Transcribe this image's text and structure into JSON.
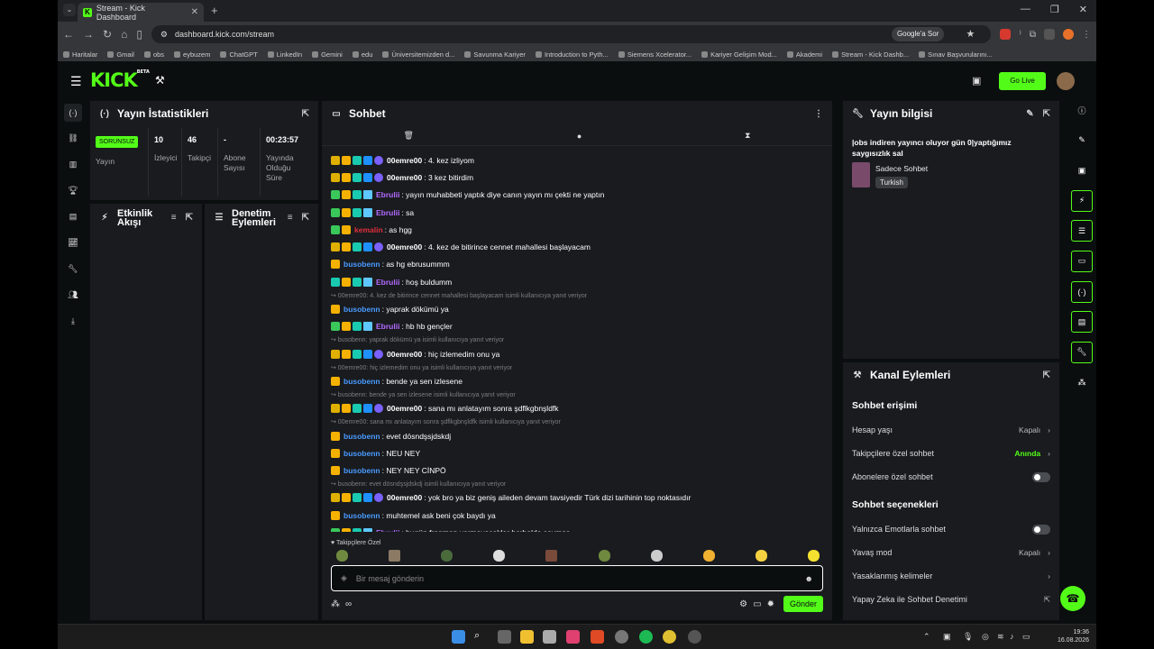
{
  "browser": {
    "tab_title": "Stream - Kick Dashboard",
    "url": "dashboard.kick.com/stream",
    "google_button": "Google'a Sor",
    "bookmarks": [
      "Haritalar",
      "Gmail",
      "obs",
      "eybuzem",
      "ChatGPT",
      "LinkedIn",
      "Gemini",
      "edu",
      "Üniversitemizden d...",
      "Savunma Kariyer",
      "Introduction to Pyth...",
      "Siemens Xcelerator...",
      "Kariyer Gelişim Mod...",
      "Akademi",
      "Stream - Kick Dashb...",
      "Sınav Başvurularını..."
    ]
  },
  "header": {
    "logo": "KICK",
    "logo_sup": "BETA",
    "go_live": "Go Live"
  },
  "stats": {
    "title": "Yayın İstatistikleri",
    "badge": "SORUNSUZ",
    "badge_label": "Yayın",
    "viewers": "10",
    "viewers_label": "İzleyici",
    "followers": "46",
    "followers_label": "Takipçi",
    "subs": "-",
    "subs_label": "Abone Sayısı",
    "duration": "00:23:57",
    "duration_label": "Yayında Olduğu Süre"
  },
  "activity": {
    "title": "Etkinlik Akışı"
  },
  "moderation": {
    "title": "Denetim Eylemleri"
  },
  "chat": {
    "title": "Sohbet",
    "followers_only": "Takipçilere Özel",
    "placeholder": "Bir mesaj gönderin",
    "send": "Gönder",
    "messages": [
      {
        "type": "msg",
        "badges": [
          "k",
          "c",
          "t",
          "s",
          "n"
        ],
        "user": "00emre00",
        "color": "#ffffff",
        "text": ": 4. kez izliyom"
      },
      {
        "type": "msg",
        "badges": [
          "k",
          "c",
          "t",
          "s",
          "n"
        ],
        "user": "00emre00",
        "color": "#ffffff",
        "text": ": 3 kez bitirdim"
      },
      {
        "type": "msg",
        "badges": [
          "g",
          "c",
          "t",
          "d"
        ],
        "user": "Ebrulii",
        "color": "#b46bff",
        "text": ": yayın muhabbeti yaptık diye canın yayın mı çekti ne yaptın"
      },
      {
        "type": "msg",
        "badges": [
          "g",
          "c",
          "t",
          "d"
        ],
        "user": "Ebrulii",
        "color": "#b46bff",
        "text": ": sa"
      },
      {
        "type": "msg",
        "badges": [
          "g",
          "c"
        ],
        "user": "kemalin",
        "color": "#e0303a",
        "text": ": as hgg"
      },
      {
        "type": "msg",
        "badges": [
          "k",
          "c",
          "t",
          "s",
          "n"
        ],
        "user": "00emre00",
        "color": "#ffffff",
        "text": ": 4. kez de bitirince cennet mahallesi başlayacam"
      },
      {
        "type": "msg",
        "badges": [
          "c"
        ],
        "user": "busobenn",
        "color": "#4a9bff",
        "text": ": as hg ebrusummm"
      },
      {
        "type": "msg",
        "badges": [
          "t",
          "c",
          "t",
          "d"
        ],
        "user": "Ebrulii",
        "color": "#b46bff",
        "text": ": hoş buldumm"
      },
      {
        "type": "reply",
        "text": "↪ 00emre00: 4. kez de bitirince cennet mahallesi başlayacam isimli kullanıcıya yanıt veriyor"
      },
      {
        "type": "msg",
        "badges": [
          "c"
        ],
        "user": "busobenn",
        "color": "#4a9bff",
        "text": ": yaprak dökümü ya"
      },
      {
        "type": "msg",
        "badges": [
          "g",
          "c",
          "t",
          "d"
        ],
        "user": "Ebrulii",
        "color": "#b46bff",
        "text": ": hb hb gençler"
      },
      {
        "type": "reply",
        "text": "↪ busobenn: yaprak dökümü ya isimli kullanıcıya yanıt veriyor"
      },
      {
        "type": "msg",
        "badges": [
          "k",
          "c",
          "t",
          "s",
          "n"
        ],
        "user": "00emre00",
        "color": "#ffffff",
        "text": ": hiç izlemedim onu ya"
      },
      {
        "type": "reply",
        "text": "↪ 00emre00: hiç izlemedim onu ya isimli kullanıcıya yanıt veriyor"
      },
      {
        "type": "msg",
        "badges": [
          "c"
        ],
        "user": "busobenn",
        "color": "#4a9bff",
        "text": ": bende ya sen izlesene"
      },
      {
        "type": "reply",
        "text": "↪ busobenn: bende ya sen izlesene isimli kullanıcıya yanıt veriyor"
      },
      {
        "type": "msg",
        "badges": [
          "k",
          "c",
          "t",
          "s",
          "n"
        ],
        "user": "00emre00",
        "color": "#ffffff",
        "text": ": sana mı anlatayım sonra şdflkgbnşldfk"
      },
      {
        "type": "reply",
        "text": "↪ 00emre00: sana mı anlatayım sonra şdflkgbnşldfk isimli kullanıcıya yanıt veriyor"
      },
      {
        "type": "msg",
        "badges": [
          "c"
        ],
        "user": "busobenn",
        "color": "#4a9bff",
        "text": ": evet dösndşsjdskdj"
      },
      {
        "type": "msg",
        "badges": [
          "c"
        ],
        "user": "busobenn",
        "color": "#4a9bff",
        "text": ": NEU NEY"
      },
      {
        "type": "msg",
        "badges": [
          "c"
        ],
        "user": "busobenn",
        "color": "#4a9bff",
        "text": ": NEY NEY CİNPÖ"
      },
      {
        "type": "reply",
        "text": "↪ busobenn: evet dösndşsjdskdj isimli kullanıcıya yanıt veriyor"
      },
      {
        "type": "msg",
        "badges": [
          "k",
          "c",
          "t",
          "s",
          "n"
        ],
        "user": "00emre00",
        "color": "#ffffff",
        "text": ": yok bro ya biz geniş aileden devam tavsiyedir Türk dizi tarihinin top noktasıdır"
      },
      {
        "type": "msg",
        "badges": [
          "c"
        ],
        "user": "busobenn",
        "color": "#4a9bff",
        "text": ": muhtemel ask beni çok baydı ya"
      },
      {
        "type": "msg",
        "badges": [
          "g",
          "c",
          "t",
          "d"
        ],
        "user": "Ebrulii",
        "color": "#b46bff",
        "text": ": bugün fragman vermeyecekler herhalde şeymoş"
      }
    ]
  },
  "stream_info": {
    "title": "Yayın bilgisi",
    "stream_title": "|obs indiren yayıncı oluyor gün 0|yaptığımız saygısızlık sal",
    "category": "Sadece Sohbet",
    "language": "Turkish"
  },
  "channel_actions": {
    "title": "Kanal Eylemleri",
    "section_access": "Sohbet erişimi",
    "account_age": "Hesap yaşı",
    "account_age_value": "Kapalı",
    "followers_only": "Takipçilere özel sohbet",
    "followers_only_value": "Anında",
    "subs_only": "Abonelere özel sohbet",
    "section_options": "Sohbet seçenekleri",
    "emotes_only": "Yalnızca Emotlarla sohbet",
    "slow_mode": "Yavaş mod",
    "slow_mode_value": "Kapalı",
    "banned_words": "Yasaklanmış kelimeler",
    "ai_moderation": "Yapay Zeka ile Sohbet Denetimi"
  },
  "taskbar": {
    "time": "19:36",
    "date": "16.08.2026"
  },
  "colors": {
    "accent": "#53fc18",
    "bg": "#0b0e0f",
    "panel": "#191b1f"
  }
}
